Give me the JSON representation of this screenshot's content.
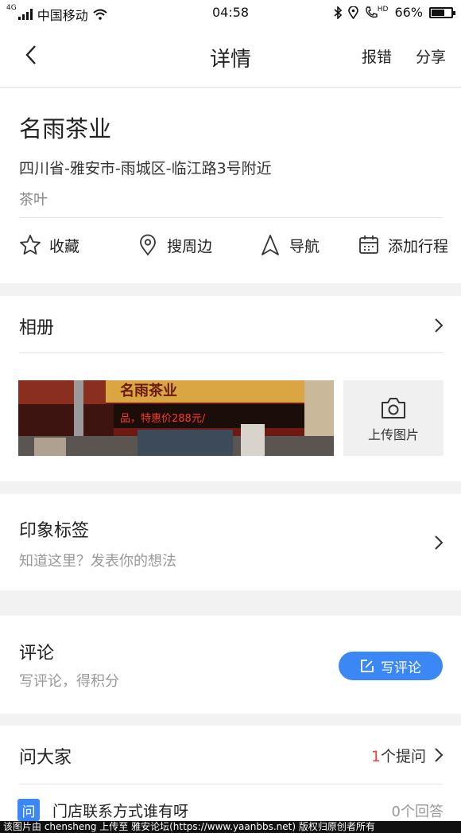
{
  "status_bar": {
    "network_type": "4G",
    "carrier": "中国移动",
    "time": "04:58",
    "hd_label": "HD",
    "battery": "66%",
    "battery_level": 0.66
  },
  "nav": {
    "title": "详情",
    "report": "报错",
    "share": "分享"
  },
  "place": {
    "name": "名雨茶业",
    "address": "四川省-雅安市-雨城区-临江路3号附近",
    "category": "茶叶"
  },
  "actions": [
    {
      "label": "收藏",
      "icon": "star-icon"
    },
    {
      "label": "搜周边",
      "icon": "location-pin-icon"
    },
    {
      "label": "导航",
      "icon": "navigation-arrow-icon"
    },
    {
      "label": "添加行程",
      "icon": "calendar-icon"
    }
  ],
  "album": {
    "title": "相册",
    "upload_label": "上传图片",
    "photo_sign_text": "名雨茶业",
    "photo_ticker_text": "品，特惠价288元/"
  },
  "tags": {
    "title": "印象标签",
    "subtitle": "知道这里？发表你的想法"
  },
  "comments": {
    "title": "评论",
    "subtitle": "写评论，得积分",
    "write_button": "写评论"
  },
  "ask": {
    "title": "问大家",
    "count": "1",
    "count_suffix": "个提问",
    "badge": "问",
    "question": "门店联系方式谁有呀",
    "answers": "0个回答"
  },
  "watermark": "该图片由 chensheng 上传至 雅安论坛(https://www.yaanbbs.net) 版权归原创者所有",
  "colors": {
    "accent": "#3a87f5",
    "count_red": "#e8453c",
    "background": "#f2f2f2"
  }
}
